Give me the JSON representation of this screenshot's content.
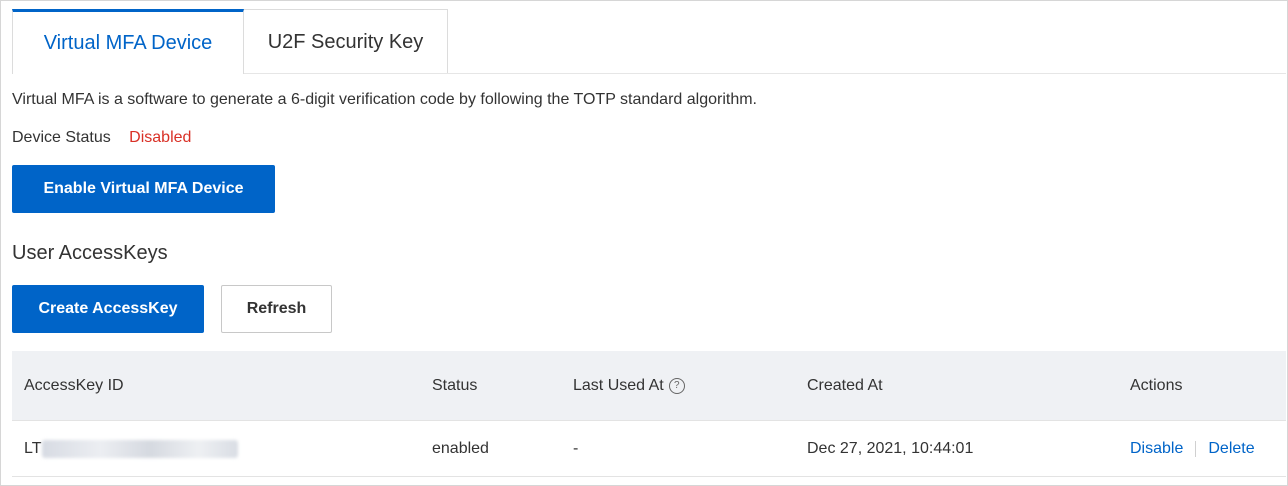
{
  "tabs": [
    {
      "label": "Virtual MFA Device",
      "active": true
    },
    {
      "label": "U2F Security Key",
      "active": false
    }
  ],
  "mfa": {
    "description": "Virtual MFA is a software to generate a 6-digit verification code by following the TOTP standard algorithm.",
    "status_label": "Device Status",
    "status_value": "Disabled",
    "enable_button": "Enable Virtual MFA Device"
  },
  "accesskeys": {
    "title": "User AccessKeys",
    "create_button": "Create AccessKey",
    "refresh_button": "Refresh",
    "columns": [
      "AccessKey ID",
      "Status",
      "Last Used At",
      "Created At",
      "Actions"
    ],
    "rows": [
      {
        "id_prefix": "LT",
        "status": "enabled",
        "last_used": "-",
        "created_at": "Dec 27, 2021, 10:44:01",
        "actions": [
          "Disable",
          "Delete"
        ]
      }
    ]
  },
  "colors": {
    "accent": "#0064c8",
    "status_disabled": "#d93026",
    "table_header_bg": "#eff1f4"
  },
  "icons": {
    "last_used_help": "question-circle-icon"
  }
}
